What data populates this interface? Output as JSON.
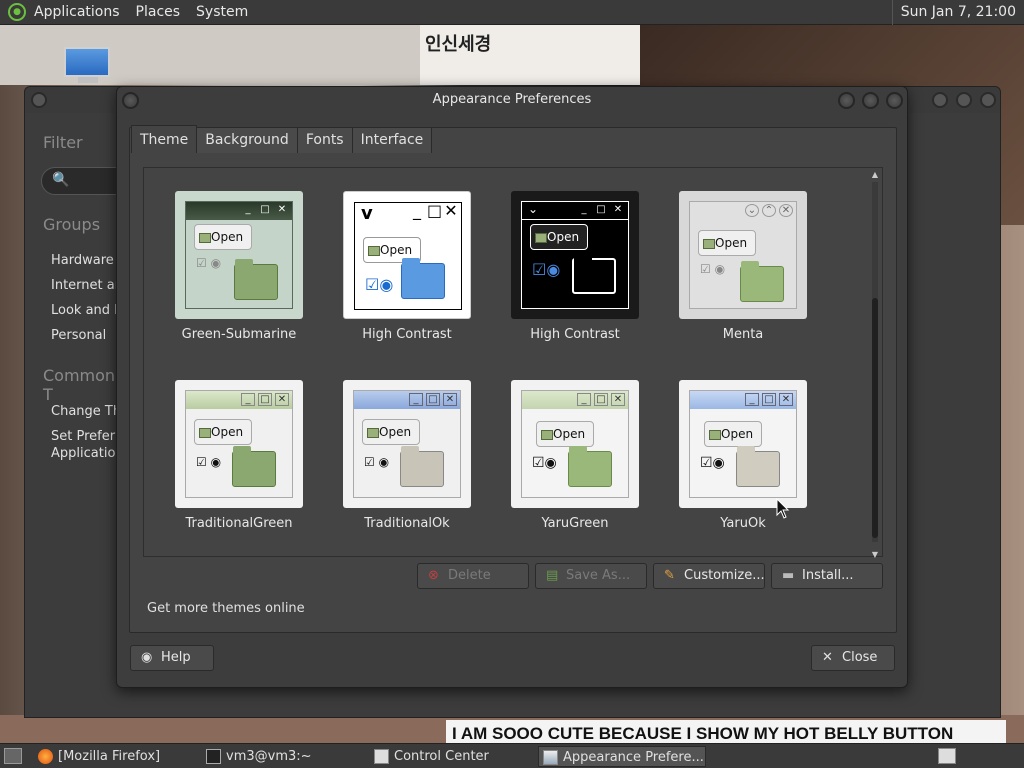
{
  "top_panel": {
    "menus": [
      "Applications",
      "Places",
      "System"
    ],
    "clock": "Sun Jan  7, 21:00"
  },
  "wallpaper": {
    "korean_text": "인신세경",
    "sign_text": "I AM SOOO CUTE BECAUSE I SHOW MY HOT BELLY BUTTON"
  },
  "control_center": {
    "filter_heading": "Filter",
    "groups_heading": "Groups",
    "groups": [
      "Hardware",
      "Internet an",
      "Look and F",
      "Personal"
    ],
    "common_heading": "Common T",
    "common": [
      "Change Th",
      "Set Preferre",
      "Application"
    ]
  },
  "dialog": {
    "title": "Appearance Preferences",
    "tabs": [
      "Theme",
      "Background",
      "Fonts",
      "Interface"
    ],
    "themes": [
      {
        "name": "Green-Submarine"
      },
      {
        "name": "High Contrast"
      },
      {
        "name": "High Contrast"
      },
      {
        "name": "Menta"
      },
      {
        "name": "TraditionalGreen"
      },
      {
        "name": "TraditionalOk"
      },
      {
        "name": "YaruGreen"
      },
      {
        "name": "YaruOk"
      }
    ],
    "open_label": "Open",
    "buttons": {
      "delete": "Delete",
      "save_as": "Save As...",
      "customize": "Customize...",
      "install": "Install..."
    },
    "more_themes_link": "Get more themes online",
    "help": "Help",
    "close": "Close"
  },
  "taskbar": {
    "tasks": [
      "[Mozilla Firefox]",
      "vm3@vm3:~",
      "Control Center",
      "Appearance Prefere..."
    ]
  }
}
